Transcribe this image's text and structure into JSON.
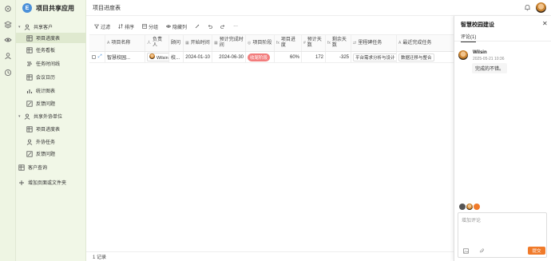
{
  "app": {
    "title": "项目共享应用",
    "logo_text": "E"
  },
  "rail": {
    "icons": [
      "settings-icon",
      "layers-icon",
      "eye-icon",
      "team-icon",
      "history-icon"
    ]
  },
  "sidebar": {
    "items": [
      {
        "label": "共享客户",
        "icon": "user-icon",
        "group": true
      },
      {
        "label": "项目进度表",
        "icon": "table-icon",
        "selected": true
      },
      {
        "label": "任务看板",
        "icon": "table-icon"
      },
      {
        "label": "任务时间线",
        "icon": "timeline-icon"
      },
      {
        "label": "会议日历",
        "icon": "table-icon"
      },
      {
        "label": "统计图表",
        "icon": "chart-icon"
      },
      {
        "label": "反馈问题",
        "icon": "edit-icon"
      },
      {
        "label": "共享外协单位",
        "icon": "user-icon",
        "group": true
      },
      {
        "label": "项目进度表",
        "icon": "table-icon"
      },
      {
        "label": "外协任务",
        "icon": "user-icon"
      },
      {
        "label": "反馈问题",
        "icon": "edit-icon"
      },
      {
        "label": "客户查询",
        "icon": "table-icon"
      },
      {
        "label": "增加页面或文件夹",
        "icon": "plus-icon"
      }
    ]
  },
  "header": {
    "page_title": "项目进度表"
  },
  "toolbar": {
    "filter": "过滤",
    "sort": "排序",
    "group": "分组",
    "hide": "隐藏列",
    "more": "···"
  },
  "table": {
    "columns": [
      {
        "label": "项目名称",
        "icon": "A"
      },
      {
        "label": "负责人",
        "icon": "人"
      },
      {
        "label": "顾问",
        "icon": ""
      },
      {
        "label": "开始时间",
        "icon": "▦"
      },
      {
        "label": "预计完成时间",
        "icon": "▦"
      },
      {
        "label": "项目阶段",
        "icon": "◎"
      },
      {
        "label": "项目进度",
        "icon": "fx"
      },
      {
        "label": "预计天数",
        "icon": "#"
      },
      {
        "label": "剩余天数",
        "icon": "fx"
      },
      {
        "label": "里程碑任务",
        "icon": "⇄"
      },
      {
        "label": "最近完成任务",
        "icon": "A"
      }
    ],
    "rows": [
      {
        "name": "智慧校园...",
        "owner": "Wilsin",
        "consultant": "校...",
        "start": "2024-01-10",
        "end": "2024-06-30",
        "stage": "收尾阶段",
        "progress": "60%",
        "est_days": "172",
        "remaining": "-325",
        "milestone": "平台需求分析与设计",
        "latest": "数据迁移与整合"
      }
    ],
    "footer": "1 记录"
  },
  "panel": {
    "title": "智慧校园建设",
    "close": "✕",
    "tab": "评论(1)",
    "comment": {
      "author": "Wilsin",
      "time": "2025-05-21 10:36",
      "text": "完成的不错。"
    },
    "input_placeholder": "增加评论",
    "submit": "提交"
  },
  "colors": {
    "accent": "#f07a2a",
    "sidebar_bg": "#f1f7e7",
    "stage_badge": "#f27c7c"
  }
}
